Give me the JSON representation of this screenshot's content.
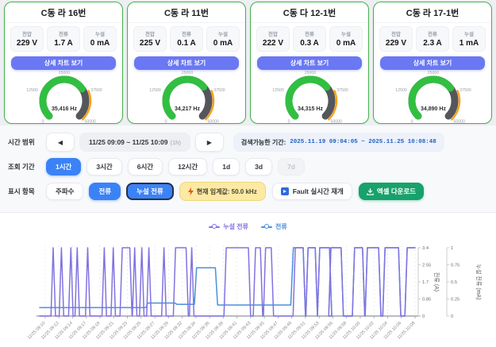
{
  "cards": [
    {
      "title": "C동 라 16번",
      "stats": [
        {
          "label": "전압",
          "value": "229 V"
        },
        {
          "label": "전류",
          "value": "1.7 A"
        },
        {
          "label": "누설",
          "value": "0 mA"
        }
      ],
      "button": "상세 차트 보기",
      "gauge": {
        "value": 35416,
        "min": 0,
        "max": 50000,
        "display": "35,416 Hz",
        "ticks": [
          "0",
          "12500",
          "25000",
          "37500",
          "50000"
        ]
      }
    },
    {
      "title": "C동 라 11번",
      "stats": [
        {
          "label": "전압",
          "value": "225 V"
        },
        {
          "label": "전류",
          "value": "0.1 A"
        },
        {
          "label": "누설",
          "value": "0 mA"
        }
      ],
      "button": "상세 차트 보기",
      "gauge": {
        "value": 34217,
        "min": 0,
        "max": 50000,
        "display": "34,217 Hz",
        "ticks": [
          "0",
          "12500",
          "25000",
          "37500",
          "50000"
        ]
      }
    },
    {
      "title": "C동 다 12-1번",
      "stats": [
        {
          "label": "전압",
          "value": "222 V"
        },
        {
          "label": "전류",
          "value": "0.3 A"
        },
        {
          "label": "누설",
          "value": "0 mA"
        }
      ],
      "button": "상세 차트 보기",
      "gauge": {
        "value": 34315,
        "min": 0,
        "max": 50000,
        "display": "34,315 Hz",
        "ticks": [
          "0",
          "12500",
          "25000",
          "37500",
          "50000"
        ]
      }
    },
    {
      "title": "C동 라 17-1번",
      "stats": [
        {
          "label": "전압",
          "value": "229 V"
        },
        {
          "label": "전류",
          "value": "2.3 A"
        },
        {
          "label": "누설",
          "value": "1 mA"
        }
      ],
      "button": "상세 차트 보기",
      "gauge": {
        "value": 34890,
        "min": 0,
        "max": 50000,
        "display": "34,890 Hz",
        "ticks": [
          "0",
          "12500",
          "25000",
          "37500",
          "50000"
        ]
      }
    }
  ],
  "controls": {
    "time_range": {
      "label": "시간 범위",
      "prev_icon": "◀",
      "next_icon": "▶",
      "range": "11/25 09:09 ~ 11/25 10:09",
      "range_suffix": "(1h)",
      "available_label": "검색가능한 기간:",
      "available_value": "2025.11.19 09:04:05 ~ 2025.11.25 10:08:48"
    },
    "period": {
      "label": "조회 기간",
      "options": [
        {
          "label": "1시간",
          "state": "active"
        },
        {
          "label": "3시간",
          "state": "normal"
        },
        {
          "label": "6시간",
          "state": "normal"
        },
        {
          "label": "12시간",
          "state": "normal"
        },
        {
          "label": "1d",
          "state": "normal"
        },
        {
          "label": "3d",
          "state": "normal"
        },
        {
          "label": "7d",
          "state": "disabled"
        }
      ]
    },
    "display": {
      "label": "표시 항목",
      "options": [
        {
          "label": "주파수",
          "state": "normal"
        },
        {
          "label": "전류",
          "state": "active"
        },
        {
          "label": "누설 전류",
          "state": "active-outlined"
        }
      ],
      "threshold_text": "현재 임계값: 50.0 kHz",
      "fault_text": "Fault 실시간 재개",
      "excel_text": "엑셀 다운로드"
    }
  },
  "chart_data": {
    "type": "line",
    "legend": [
      {
        "name": "누설 전류",
        "color": "#8173e0"
      },
      {
        "name": "전류",
        "color": "#4a90d9"
      }
    ],
    "x_range": [
      "11/25 09:09",
      "11/25 10:09"
    ],
    "x_ticks": [
      "11/25 09:10",
      "11/25 09:12",
      "11/25 09:14",
      "11/25 09:17",
      "11/25 09:19",
      "11/25 09:21",
      "11/25 09:23",
      "11/25 09:25",
      "11/25 09:27",
      "11/25 09:29",
      "11/25 09:32",
      "11/25 09:34",
      "11/25 09:36",
      "11/25 09:38",
      "11/25 09:41",
      "11/25 09:43",
      "11/25 09:45",
      "11/25 09:47",
      "11/25 09:49",
      "11/25 09:51",
      "11/25 09:53",
      "11/25 09:56",
      "11/25 09:58",
      "11/25 10:00",
      "11/25 10:02",
      "11/25 10:04",
      "11/25 10:06",
      "11/25 10:08"
    ],
    "y_axis_right_inner": {
      "name": "전류 (A)",
      "ticks": [
        0,
        0.85,
        1.7,
        2.55,
        3.4
      ],
      "max": 3.4
    },
    "y_axis_right_outer": {
      "name": "누설 전류 (mA)",
      "ticks": [
        0,
        0.25,
        0.5,
        0.75,
        1
      ],
      "max": 1
    },
    "series": [
      {
        "name": "누설 전류",
        "unit": "mA",
        "color": "#8173e0",
        "amplitude": 1,
        "ramp": 0.006,
        "pulses": [
          [
            0.036,
            0.036
          ],
          [
            0.058,
            0.058
          ],
          [
            0.083,
            0.083
          ],
          [
            0.1,
            0.1
          ],
          [
            0.128,
            0.128
          ],
          [
            0.172,
            0.172
          ],
          [
            0.196,
            0.196
          ],
          [
            0.22,
            0.24
          ],
          [
            0.253,
            0.253
          ],
          [
            0.272,
            0.272
          ],
          [
            0.291,
            0.291
          ],
          [
            0.331,
            0.331
          ],
          [
            0.362,
            0.39
          ],
          [
            0.405,
            0.405
          ],
          [
            0.497,
            0.556
          ],
          [
            0.575,
            0.588
          ],
          [
            0.602,
            0.617
          ],
          [
            0.681,
            0.702
          ],
          [
            0.715,
            0.734
          ],
          [
            0.746,
            0.772
          ],
          [
            0.776,
            0.803
          ],
          [
            0.839,
            0.86
          ],
          [
            0.873,
            0.903
          ],
          [
            0.92,
            0.956
          ],
          [
            0.979,
            1.0
          ]
        ]
      },
      {
        "name": "전류",
        "unit": "A",
        "color": "#4a90d9",
        "max": 3.4,
        "points": [
          [
            0,
            0.42
          ],
          [
            0.283,
            0.42
          ],
          [
            0.288,
            0.65
          ],
          [
            0.36,
            0.65
          ],
          [
            0.366,
            0.58
          ],
          [
            0.412,
            0.58
          ],
          [
            0.418,
            2.4
          ],
          [
            0.468,
            2.4
          ],
          [
            0.474,
            0.55
          ],
          [
            0.669,
            0.55
          ],
          [
            0.676,
            3.4
          ],
          [
            0.702,
            3.4
          ],
          [
            0.708,
            0
          ]
        ],
        "follow_from": 0.71,
        "follow_amplitude": 3.4
      }
    ]
  }
}
